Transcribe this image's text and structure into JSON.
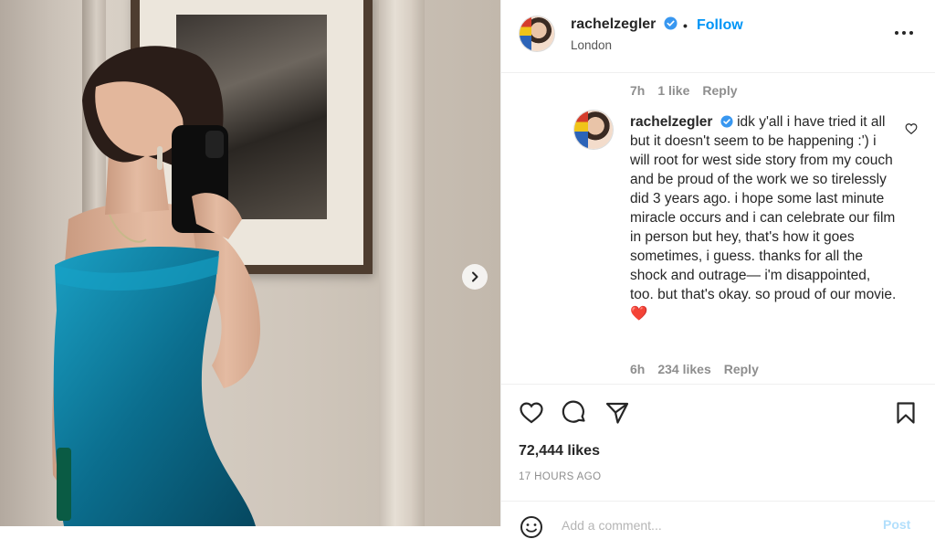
{
  "post": {
    "username": "rachelzegler",
    "follow_label": "Follow",
    "location": "London",
    "separator": "•"
  },
  "comments": {
    "prev_meta": {
      "time": "7h",
      "likes": "1 like",
      "reply": "Reply"
    },
    "main": {
      "username": "rachelzegler",
      "text": "idk y'all i have tried it all but it doesn't seem to be happening :') i will root for west side story from my couch and be proud of the work we so tirelessly did 3 years ago. i hope some last minute miracle occurs and i can celebrate our film in person but hey, that's how it goes sometimes, i guess. thanks for all the shock and outrage— i'm disappointed, too. but that's okay. so proud of our movie. ❤️",
      "time": "6h",
      "likes": "234 likes",
      "reply": "Reply"
    }
  },
  "stats": {
    "likes": "72,444 likes",
    "time_ago": "17 HOURS AGO"
  },
  "add_comment": {
    "placeholder": "Add a comment...",
    "post_label": "Post"
  },
  "icons": {
    "verified": "verified-badge-icon",
    "more": "more-options-icon",
    "like": "heart-icon",
    "comment": "comment-icon",
    "share": "paper-plane-icon",
    "save": "bookmark-icon",
    "next": "chevron-right-icon",
    "emoji": "emoji-icon"
  },
  "colors": {
    "accent": "#0095f6",
    "text": "#262626",
    "muted": "#8e8e8e",
    "dress": "#0e6f8f"
  }
}
